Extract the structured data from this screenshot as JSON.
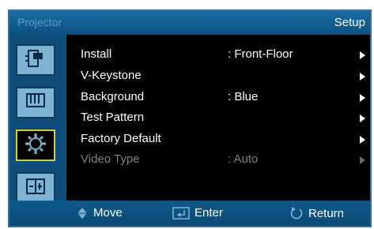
{
  "title_bar": {
    "left": "Projector",
    "right": "Setup"
  },
  "sidebar": {
    "tabs": [
      {
        "name": "input-source-icon",
        "active": false
      },
      {
        "name": "picture-icon",
        "active": false
      },
      {
        "name": "setup-gear-icon",
        "active": true
      },
      {
        "name": "advanced-icon",
        "active": false
      }
    ]
  },
  "menu": {
    "items": [
      {
        "label": "Install",
        "value": ": Front-Floor",
        "enabled": true
      },
      {
        "label": "V-Keystone",
        "value": "",
        "enabled": true
      },
      {
        "label": "Background",
        "value": ": Blue",
        "enabled": true
      },
      {
        "label": "Test Pattern",
        "value": "",
        "enabled": true
      },
      {
        "label": "Factory Default",
        "value": "",
        "enabled": true
      },
      {
        "label": "Video Type",
        "value": ": Auto",
        "enabled": false
      }
    ]
  },
  "bottom_bar": {
    "move": "Move",
    "enter": "Enter",
    "return": "Return"
  },
  "colors": {
    "title_bg": "#1a6ea3",
    "sidebar_bg": "#0f4d7a",
    "active_border": "#d8cc3a",
    "disabled_text": "#808080"
  }
}
